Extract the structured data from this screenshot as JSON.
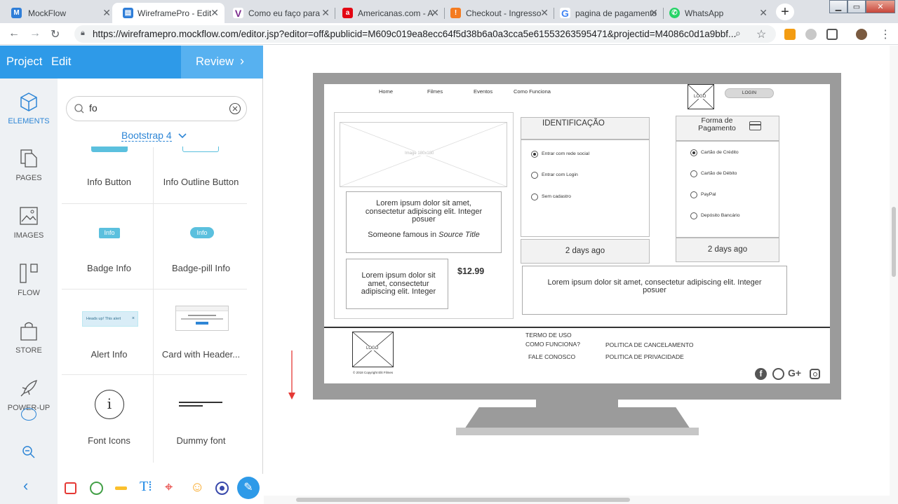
{
  "browser": {
    "tabs": [
      {
        "title": "MockFlow",
        "icon": "mockflow-icon",
        "color": "#2f7ed8"
      },
      {
        "title": "WireframePro - Edit",
        "icon": "wireframepro-icon",
        "color": "#2f7ed8"
      },
      {
        "title": "Como eu faço para",
        "icon": "v-icon",
        "color": "#7b2d8e"
      },
      {
        "title": "Americanas.com - A",
        "icon": "americanas-icon",
        "color": "#e30613"
      },
      {
        "title": "Checkout - Ingresso",
        "icon": "ingresso-icon",
        "color": "#f47b20"
      },
      {
        "title": "pagina de pagamento",
        "icon": "google-icon",
        "color": "#4285f4"
      },
      {
        "title": "WhatsApp",
        "icon": "whatsapp-icon",
        "color": "#25d366"
      }
    ],
    "url": "https://wireframepro.mockflow.com/editor.jsp?editor=off&publicid=M609c019ea8ecc64f5d38b6a0a3cca5e61553263595471&projectid=M4086c0d1a9bbf..."
  },
  "editor": {
    "menu": {
      "project": "Project",
      "edit": "Edit",
      "review": "Review"
    },
    "sidenav": [
      {
        "label": "ELEMENTS",
        "icon": "cube-icon",
        "active": true
      },
      {
        "label": "PAGES",
        "icon": "pages-icon"
      },
      {
        "label": "IMAGES",
        "icon": "images-icon"
      },
      {
        "label": "FLOW",
        "icon": "flow-icon"
      },
      {
        "label": "STORE",
        "icon": "store-icon"
      },
      {
        "label": "POWER-UP",
        "icon": "rocket-icon"
      }
    ],
    "search": {
      "value": "fo"
    },
    "library": {
      "selected": "Bootstrap 4"
    },
    "components": [
      {
        "label": "Info Button"
      },
      {
        "label": "Info Outline Button"
      },
      {
        "label": "Badge Info",
        "preview": "Info"
      },
      {
        "label": "Badge-pill Info",
        "preview": "Info"
      },
      {
        "label": "Alert Info",
        "preview": "Heads up! This alert"
      },
      {
        "label": "Card with Header..."
      },
      {
        "label": "Font Icons",
        "preview": "i"
      },
      {
        "label": "Dummy font"
      }
    ],
    "colors": {
      "accent": "#2e9ae8",
      "info": "#5bc0de"
    }
  },
  "wireframe": {
    "nav": [
      "Home",
      "Filmes",
      "Eventos",
      "Como Funciona"
    ],
    "logo": "LOGO",
    "login": "LOGIN",
    "image_placeholder": "Image 180x180",
    "quote": {
      "text": "Lorem ipsum dolor sit amet, consectetur adipiscing elit. Integer posuer",
      "footer": "Someone famous in ",
      "source": "Source Title"
    },
    "small_card": "Lorem ipsum dolor sit amet, consectetur adipiscing elit. Integer",
    "price": "$12.99",
    "identificacao": {
      "title": "IDENTIFICAÇÃO",
      "options": [
        "Entrar com rede social",
        "Entrar com Login",
        "Sem cadastro"
      ],
      "footer": "2 days ago"
    },
    "pagamento": {
      "title_line1": "Forma de",
      "title_line2": "Pagamento",
      "options": [
        "Cartão de Crédito",
        "Cartão de Débito",
        "PayPal",
        "Depósito Bancário"
      ],
      "footer": "2 days ago"
    },
    "lorem_wide": "Lorem ipsum dolor sit amet, consectetur adipiscing elit. Integer posuer",
    "footer": {
      "logo": "LOGO",
      "copyright": "© 2018 Copyright Elit Filmes",
      "links_col1": [
        "TERMO DE USO",
        "COMO FUNCIONA?",
        "FALE CONOSCO"
      ],
      "links_col2": [
        "POLITICA DE CANCELAMENTO",
        "POLITICA DE PRIVACIDADE"
      ],
      "social": [
        "facebook-icon",
        "github-icon",
        "G+",
        "instagram-icon"
      ]
    }
  }
}
